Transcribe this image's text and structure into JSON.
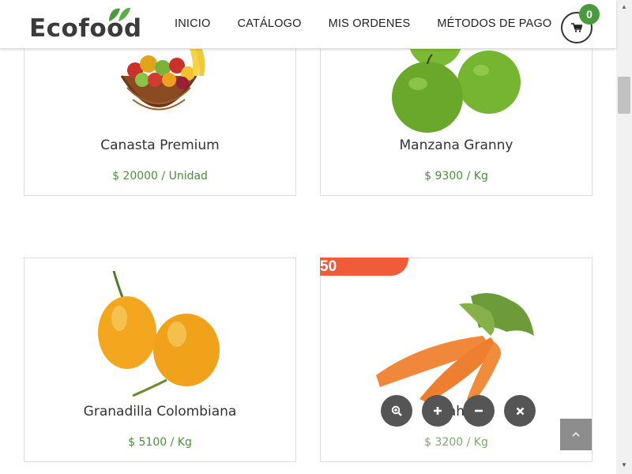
{
  "brand": {
    "name": "Ecofood"
  },
  "nav": {
    "items": [
      {
        "label": "INICIO"
      },
      {
        "label": "CATÁLOGO"
      },
      {
        "label": "MIS ORDENES"
      },
      {
        "label": "MÉTODOS DE PAGO"
      }
    ]
  },
  "cart": {
    "count": "0",
    "icon": "shopping-cart-icon"
  },
  "products": [
    {
      "name": "Canasta Premium",
      "price": "$ 20000 / Unidad"
    },
    {
      "name": "Manzana Granny",
      "price": "$ 9300 / Kg"
    },
    {
      "name": "Granadilla Colombiana",
      "price": "$ 5100 / Kg"
    },
    {
      "name": "Zanahoria",
      "visible_name": "ah",
      "price": "$ 3200 / Kg",
      "sale_badge": "50"
    }
  ],
  "colors": {
    "accent_green": "#4b9a3d",
    "price_green": "#4a8f3a",
    "sale_red": "#f05c3a",
    "action_gray": "#555555"
  },
  "actions": [
    {
      "icon": "zoom-in-icon"
    },
    {
      "icon": "plus-icon"
    },
    {
      "icon": "minus-icon"
    },
    {
      "icon": "close-icon"
    }
  ]
}
